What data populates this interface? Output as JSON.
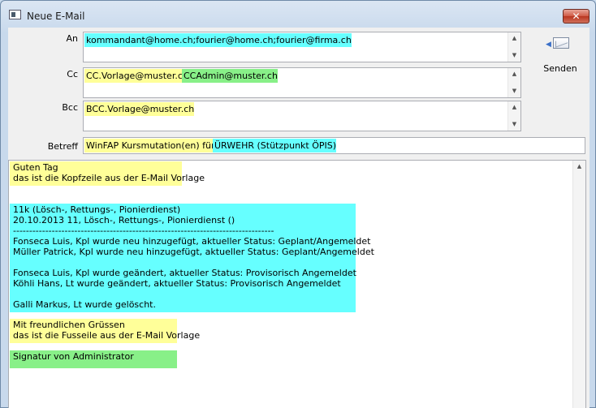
{
  "window": {
    "title": "Neue E-Mail",
    "close_glyph": "✕"
  },
  "fields": {
    "to": {
      "label": "An",
      "segments": [
        "kommandant@home.ch;fourier@home.ch;fourier@firma.ch"
      ]
    },
    "cc": {
      "label": "Cc",
      "segments": [
        "CC.Vorlage@muster.ch;",
        "CCAdmin@muster.ch"
      ]
    },
    "bcc": {
      "label": "Bcc",
      "segments": [
        "BCC.Vorlage@muster.ch"
      ]
    },
    "subject": {
      "label": "Betreff",
      "segments": [
        "WinFAP Kursmutation(en) für F",
        "ÜRWEHR  (Stützpunkt ÖPIS)"
      ]
    }
  },
  "toolbar": {
    "send_label": "Senden",
    "send_icon": "send-mail-icon"
  },
  "scroll_glyphs": {
    "up": "▲",
    "down": "▼"
  },
  "body": {
    "header": "Guten Tag\ndas ist die Kopfzeile aus der E-Mail Vorlage",
    "content": "11k (Lösch-, Rettungs-, Pionierdienst)\n20.10.2013 11, Lösch-, Rettungs-, Pionierdienst ()\n---------------------------------------------------------------------------------\nFonseca Luis, Kpl wurde neu hinzugefügt, aktueller Status: Geplant/Angemeldet\nMüller Patrick, Kpl wurde neu hinzugefügt, aktueller Status: Geplant/Angemeldet\n\nFonseca Luis, Kpl wurde geändert, aktueller Status: Provisorisch Angemeldet\nKöhli Hans, Lt wurde geändert, aktueller Status: Provisorisch Angemeldet\n\nGalli Markus, Lt wurde gelöscht.",
    "footer": "Mit freundlichen Grüssen\ndas ist die Fusseile aus der E-Mail Vorlage",
    "signature": "Signatur von Administrator"
  },
  "colors": {
    "cyan": "#66ffff",
    "yellow": "#ffff99",
    "green": "#88f088"
  }
}
